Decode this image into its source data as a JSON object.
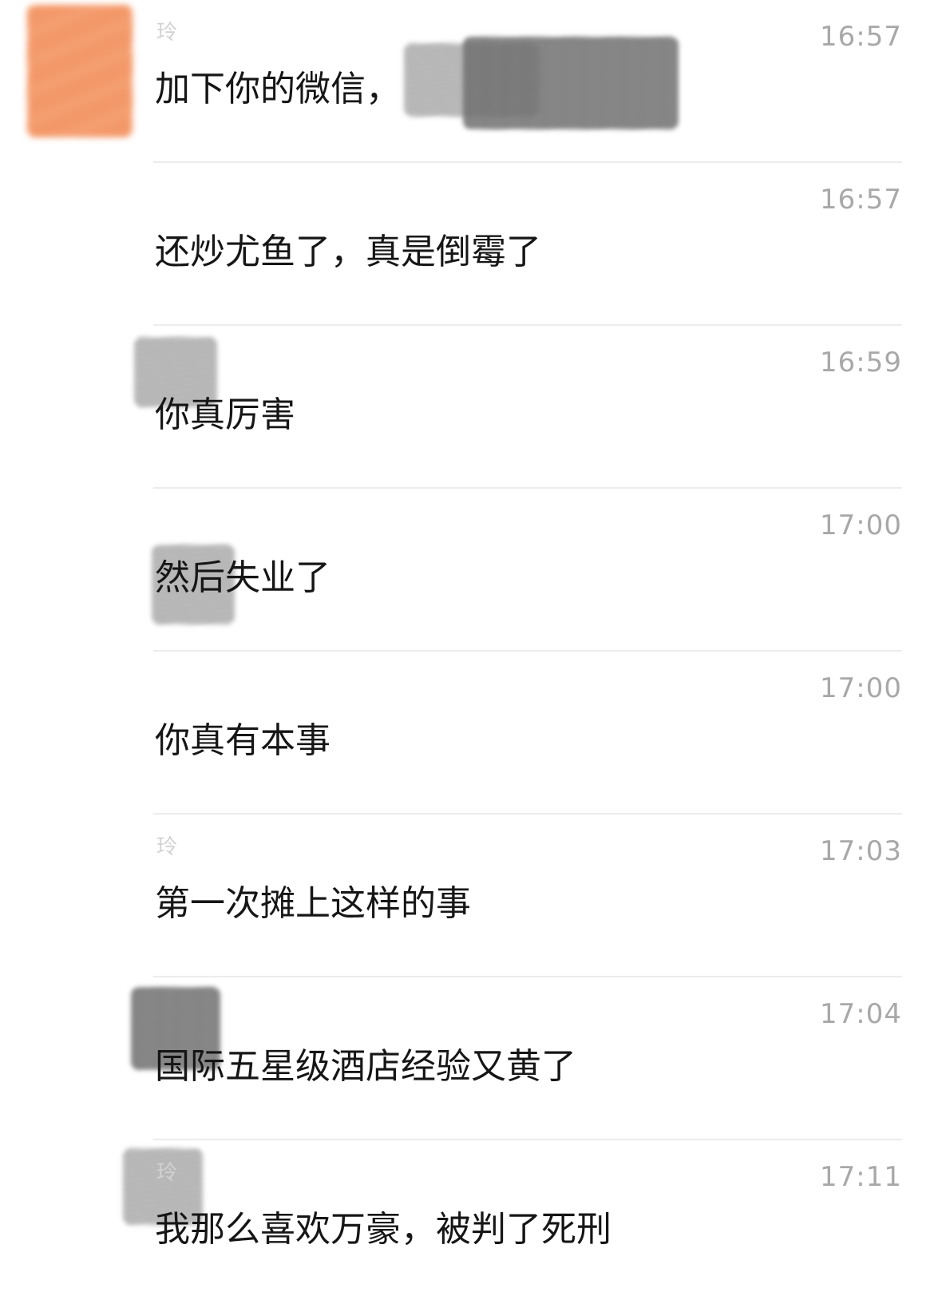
{
  "chat_history": {
    "messages": [
      {
        "sender": "玲",
        "time": "16:57",
        "text": "加下你的微信，"
      },
      {
        "sender": "",
        "time": "16:57",
        "text": "还炒尤鱼了，真是倒霉了"
      },
      {
        "sender": "",
        "time": "16:59",
        "text": "你真厉害"
      },
      {
        "sender": "",
        "time": "17:00",
        "text": "然后失业了"
      },
      {
        "sender": "",
        "time": "17:00",
        "text": "你真有本事"
      },
      {
        "sender": "玲",
        "time": "17:03",
        "text": "第一次摊上这样的事"
      },
      {
        "sender": "",
        "time": "17:04",
        "text": "国际五星级酒店经验又黄了"
      },
      {
        "sender": "玲",
        "time": "17:11",
        "text": "我那么喜欢万豪，被判了死刑"
      }
    ]
  },
  "colors": {
    "message_text": "#161616",
    "timestamp": "#a8a8a8",
    "divider": "#ececec",
    "avatar_redaction": "#f39a6a",
    "redaction": "#bdbdbd"
  }
}
